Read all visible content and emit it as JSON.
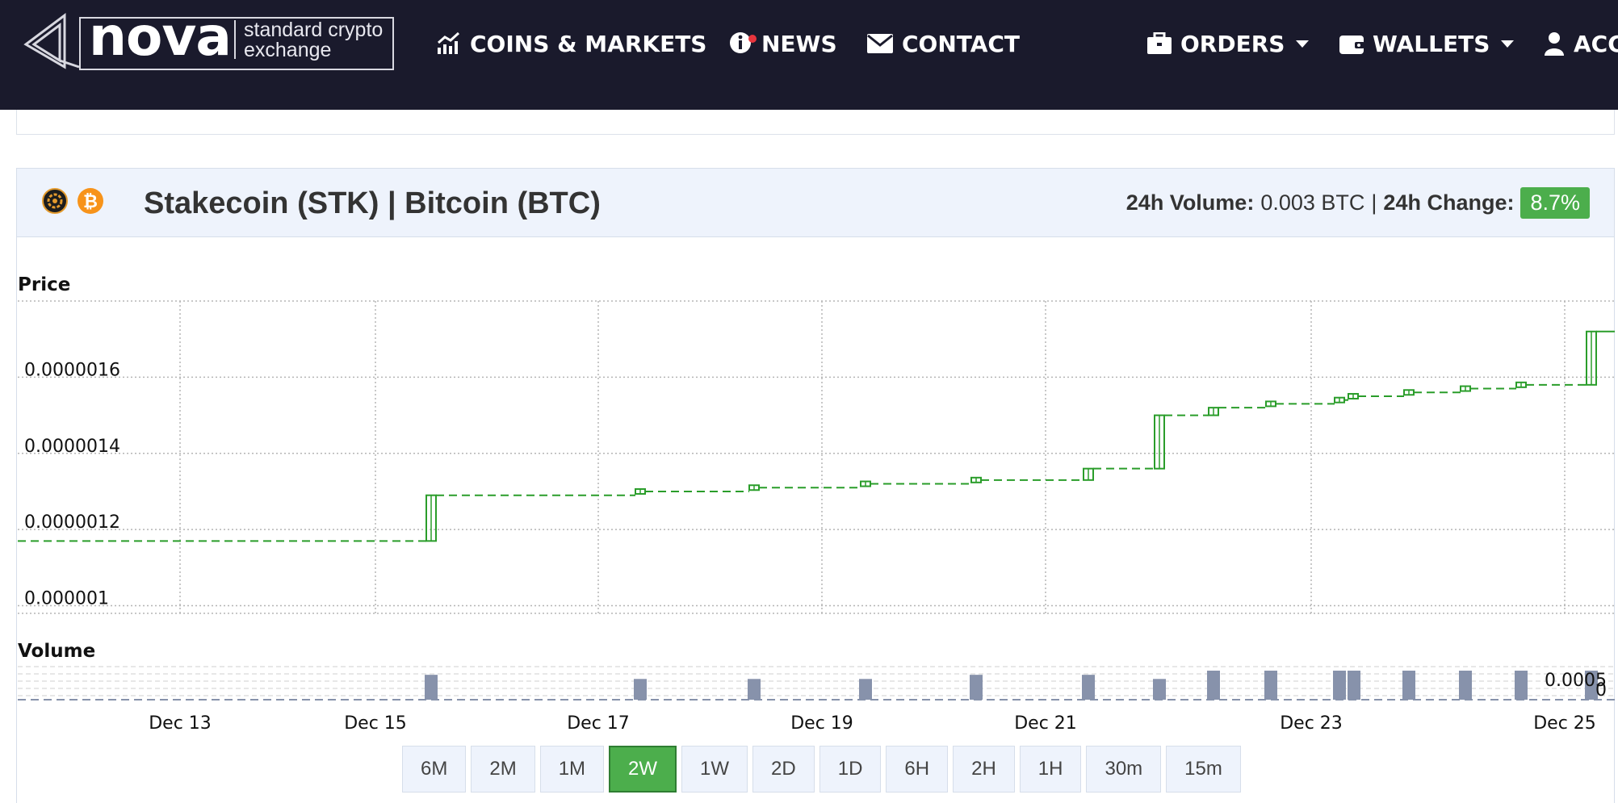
{
  "nav": {
    "logo_word": "nova",
    "logo_tagline": "standard crypto exchange",
    "items": [
      {
        "label": "COINS & MARKETS",
        "icon": "chart-line-icon"
      },
      {
        "label": "NEWS",
        "icon": "info-icon"
      },
      {
        "label": "CONTACT",
        "icon": "envelope-icon"
      },
      {
        "label": "ORDERS",
        "icon": "briefcase-icon"
      },
      {
        "label": "WALLETS",
        "icon": "wallet-icon"
      },
      {
        "label": "ACC",
        "icon": "user-icon"
      }
    ]
  },
  "market": {
    "title": "Stakecoin (STK) | Bitcoin (BTC)",
    "volume_label": "24h Volume:",
    "volume_value": "0.003 BTC",
    "separator": "|",
    "change_label": "24h Change:",
    "change_value": "8.7%",
    "icons": [
      "stakecoin-icon",
      "bitcoin-icon"
    ]
  },
  "colors": {
    "nav_bg": "#1a1a2c",
    "candle": "#2a9d2a",
    "volume_bar": "#8792ab",
    "accent_green": "#4cae4c"
  },
  "chart_data": [
    {
      "type": "candlestick",
      "title": "Price",
      "ylim": [
        9.8e-07,
        1.8e-06
      ],
      "y_ticks": [
        "0.0000016",
        "0.0000014",
        "0.0000012",
        "0.000001"
      ],
      "x_ticks": [
        "Dec 13",
        "Dec 15",
        "Dec 17",
        "Dec 19",
        "Dec 21",
        "Dec 23",
        "Dec 25"
      ],
      "grid": true,
      "candles": [
        {
          "date": "Dec 15",
          "open": 1.17e-06,
          "close": 1.29e-06
        },
        {
          "date": "Dec 16",
          "open": 1.29e-06,
          "close": 1.3e-06
        },
        {
          "date": "Dec 17",
          "open": 1.3e-06,
          "close": 1.31e-06
        },
        {
          "date": "Dec 18",
          "open": 1.31e-06,
          "close": 1.32e-06
        },
        {
          "date": "Dec 19",
          "open": 1.32e-06,
          "close": 1.33e-06
        },
        {
          "date": "Dec 20",
          "open": 1.33e-06,
          "close": 1.36e-06
        },
        {
          "date": "Dec 21",
          "open": 1.36e-06,
          "close": 1.5e-06
        },
        {
          "date": "Dec 22",
          "open": 1.5e-06,
          "close": 1.52e-06
        },
        {
          "date": "Dec 22b",
          "open": 1.52e-06,
          "close": 1.53e-06
        },
        {
          "date": "Dec 23",
          "open": 1.53e-06,
          "close": 1.54e-06
        },
        {
          "date": "Dec 23b",
          "open": 1.54e-06,
          "close": 1.55e-06
        },
        {
          "date": "Dec 24",
          "open": 1.55e-06,
          "close": 1.56e-06
        },
        {
          "date": "Dec 24b",
          "open": 1.56e-06,
          "close": 1.57e-06
        },
        {
          "date": "Dec 24c",
          "open": 1.57e-06,
          "close": 1.58e-06
        },
        {
          "date": "Dec 25",
          "open": 1.58e-06,
          "close": 1.72e-06
        }
      ]
    },
    {
      "type": "bar",
      "title": "Volume",
      "y_ticks": [
        "0.0005",
        "0"
      ],
      "series": [
        {
          "values": [
            0.0006,
            0.0005,
            0.0005,
            0.0005,
            0.0006,
            0.0006,
            0.0005,
            0.0007,
            0.0007,
            0.0007,
            0.0007,
            0.0007,
            0.0007,
            0.0007,
            0.0007,
            0.0006
          ]
        }
      ]
    }
  ],
  "range_buttons": [
    {
      "label": "6M",
      "active": false
    },
    {
      "label": "2M",
      "active": false
    },
    {
      "label": "1M",
      "active": false
    },
    {
      "label": "2W",
      "active": true
    },
    {
      "label": "1W",
      "active": false
    },
    {
      "label": "2D",
      "active": false
    },
    {
      "label": "1D",
      "active": false
    },
    {
      "label": "6H",
      "active": false
    },
    {
      "label": "2H",
      "active": false
    },
    {
      "label": "1H",
      "active": false
    },
    {
      "label": "30m",
      "active": false
    },
    {
      "label": "15m",
      "active": false
    }
  ]
}
